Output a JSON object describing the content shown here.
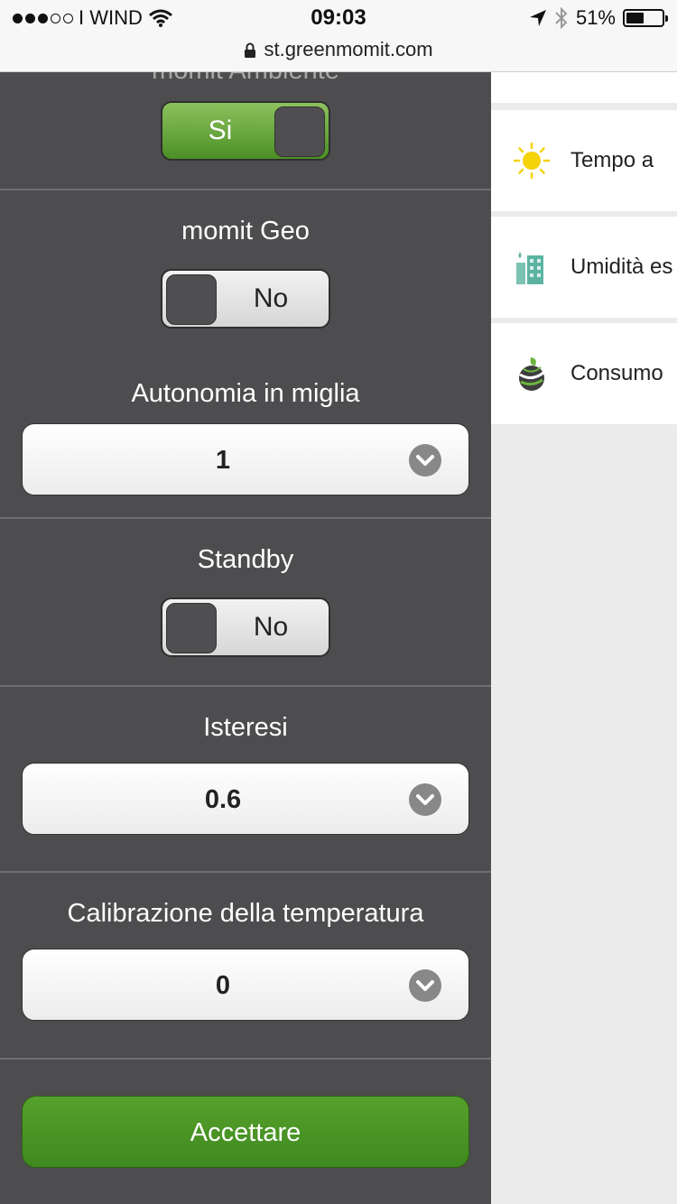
{
  "status_bar": {
    "carrier": "I WIND",
    "time": "09:03",
    "battery_percent": "51%",
    "battery_level": 0.51,
    "url": "st.greenmomit.com"
  },
  "settings": {
    "partial_title": "momit Ambiente",
    "ambiente_toggle": "Si",
    "geo_label": "momit Geo",
    "geo_toggle": "No",
    "autonomy_label": "Autonomia in miglia",
    "autonomy_value": "1",
    "standby_label": "Standby",
    "standby_toggle": "No",
    "hysteresis_label": "Isteresi",
    "hysteresis_value": "0.6",
    "calibration_label": "Calibrazione della temperatura",
    "calibration_value": "0",
    "accept_button": "Accettare"
  },
  "right_list": [
    {
      "label": "Tempo a",
      "icon": "sun-icon"
    },
    {
      "label": "Umidità es",
      "icon": "building-humidity-icon"
    },
    {
      "label": "Consumo",
      "icon": "eco-globe-icon"
    }
  ],
  "colors": {
    "panel_bg": "#4d4d4f",
    "toggle_on": "#5fa334",
    "accept_green": "#4a9424"
  }
}
